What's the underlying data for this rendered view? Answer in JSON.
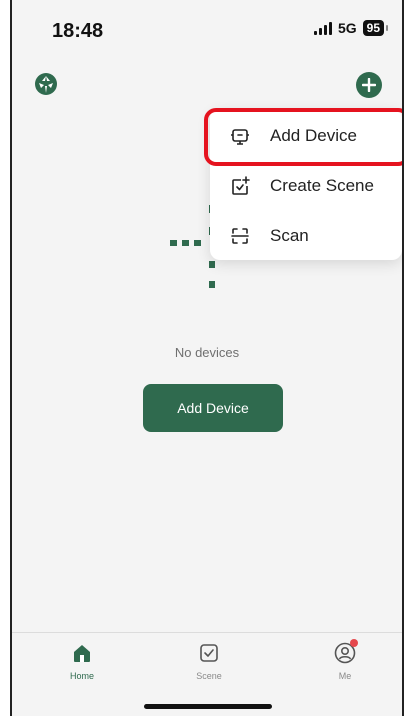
{
  "status": {
    "time": "18:48",
    "network": "5G",
    "battery": "95"
  },
  "header": {
    "logo_icon": "leaf-logo-icon",
    "add_icon": "plus-circle-icon"
  },
  "empty_state": {
    "message": "No devices",
    "button_label": "Add Device"
  },
  "menu": {
    "items": [
      {
        "label": "Add Device",
        "icon": "add-device-icon",
        "highlighted": true
      },
      {
        "label": "Create Scene",
        "icon": "create-scene-icon"
      },
      {
        "label": "Scan",
        "icon": "scan-icon"
      }
    ]
  },
  "tabs": [
    {
      "label": "Home",
      "icon": "home-icon",
      "active": true
    },
    {
      "label": "Scene",
      "icon": "scene-icon",
      "active": false
    },
    {
      "label": "Me",
      "icon": "profile-icon",
      "active": false,
      "badge": true
    }
  ],
  "colors": {
    "accent": "#2f6a4e",
    "highlight": "#e5131f",
    "badge": "#e5484d"
  }
}
